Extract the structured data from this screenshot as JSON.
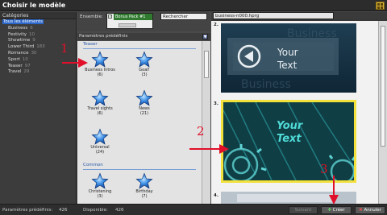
{
  "window": {
    "title": "Choisir le modèle"
  },
  "categories": {
    "header": "Catégories",
    "items": [
      {
        "label": "Tous les éléments",
        "count": "",
        "selected": true
      },
      {
        "label": "Business",
        "count": "6"
      },
      {
        "label": "Festivity",
        "count": "10"
      },
      {
        "label": "Showtime",
        "count": "9"
      },
      {
        "label": "Lower Third",
        "count": "183"
      },
      {
        "label": "Romance",
        "count": "30"
      },
      {
        "label": "Sport",
        "count": "10"
      },
      {
        "label": "Teaser",
        "count": "97"
      },
      {
        "label": "Travel",
        "count": "29"
      }
    ]
  },
  "filter": {
    "ensemble_label": "Ensemble:",
    "ensemble_value": "Bonus Pack #1",
    "search_placeholder": "Rechercher"
  },
  "presets": {
    "header": "Paramètres prédéfinis",
    "sections": [
      {
        "title": "Teaser",
        "items": [
          {
            "label": "Business Intros",
            "count": "(6)"
          },
          {
            "label": "Goal!",
            "count": "(3)"
          },
          {
            "label": "Travel sights",
            "count": "(6)"
          },
          {
            "label": "News",
            "count": "(21)"
          },
          {
            "label": "Universal",
            "count": "(24)"
          }
        ]
      },
      {
        "title": "Common",
        "items": [
          {
            "label": "Christening",
            "count": "(3)"
          },
          {
            "label": "Birthday",
            "count": "(7)"
          }
        ]
      }
    ]
  },
  "preview": {
    "filename": "business-n000.hprg",
    "thumbnails": [
      {
        "index": "2.",
        "line1": "Your",
        "line2": "Text",
        "bg_word": "Business"
      },
      {
        "index": "3.",
        "line1": "Your",
        "line2": "Text"
      },
      {
        "index": "4."
      }
    ]
  },
  "status": {
    "presets_label": "Paramètres prédéfinis:",
    "presets_value": "426",
    "available_label": "Disponible:",
    "available_value": "426",
    "suivant": "Suivant",
    "create": "Créer",
    "cancel": "Annuler"
  },
  "annotations": [
    "1",
    "2",
    "3"
  ],
  "colors": {
    "accent_selection": "#2c66c8",
    "star_blue": "#1f6fd0",
    "section_blue": "#2a5aa8",
    "highlight_yellow": "#f1e13a",
    "annotation_red": "#e0102a",
    "ensemble_green": "#2f7a2f"
  }
}
